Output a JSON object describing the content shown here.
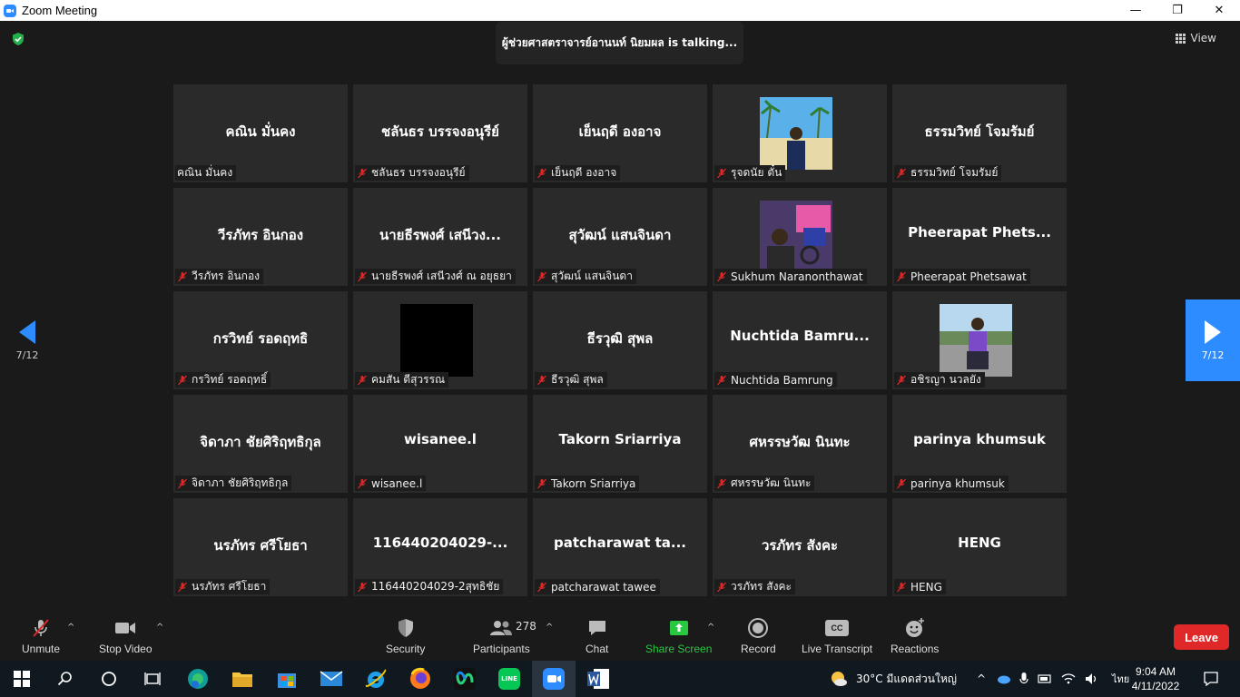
{
  "window": {
    "title": "Zoom Meeting",
    "minimize": "—",
    "restore": "❐",
    "close": "✕"
  },
  "meeting": {
    "talking": "ผู้ช่วยศาสตราจารย์อานนท์ นิยมผล is  talking...",
    "view_label": "View",
    "page_left": "7/12",
    "page_right": "7/12"
  },
  "participants": [
    {
      "big": "คณิน  มั่นคง",
      "label": "คณิน  มั่นคง",
      "muted": false
    },
    {
      "big": "ชลันธร บรรจงอนุรีย์",
      "label": "ชลันธร บรรจงอนุรีย์",
      "muted": true
    },
    {
      "big": "เย็นฤดี องอาจ",
      "label": "เย็นฤดี องอาจ",
      "muted": true
    },
    {
      "big": "",
      "label": "รุจดนัย ตั๋น",
      "muted": true,
      "photo": "beach"
    },
    {
      "big": "ธรรมวิทย์ โจมรัมย์",
      "label": "ธรรมวิทย์ โจมรัมย์",
      "muted": true
    },
    {
      "big": "วีรภัทร อินกอง",
      "label": "วีรภัทร อินกอง",
      "muted": true
    },
    {
      "big": "นายธีรพงศ์ เสนีวง...",
      "label": "นายธีรพงศ์ เสนีวงศ์ ณ อยุธยา",
      "muted": true
    },
    {
      "big": "สุวัฒน์ แสนจินดา",
      "label": "สุวัฒน์ แสนจินดา",
      "muted": true
    },
    {
      "big": "",
      "label": "Sukhum Naranonthawat",
      "muted": true,
      "photo": "arcade"
    },
    {
      "big": "Pheerapat  Phets...",
      "label": "Pheerapat Phetsawat",
      "muted": true
    },
    {
      "big": "กรวิทย์ รอดฤทธิ",
      "label": "กรวิทย์ รอดฤทธิ์",
      "muted": true
    },
    {
      "big": "",
      "label": "คมสัน ตีสุวรรณ",
      "muted": true,
      "photo": "black"
    },
    {
      "big": "ธีรวุฒิ สุพล",
      "label": "ธีรวุฒิ สุพล",
      "muted": true
    },
    {
      "big": "Nuchtida  Bamru...",
      "label": "Nuchtida Bamrung",
      "muted": true
    },
    {
      "big": "",
      "label": "อชิรญา นวลยัง",
      "muted": true,
      "photo": "road"
    },
    {
      "big": "จิดาภา ชัยศิริฤทธิกุล",
      "label": "จิดาภา ชัยศิริฤทธิกุล",
      "muted": true
    },
    {
      "big": "wisanee.l",
      "label": "wisanee.l",
      "muted": true
    },
    {
      "big": "Takorn Sriarriya",
      "label": "Takorn Sriarriya",
      "muted": true
    },
    {
      "big": "ศหรรษวัฒ นินทะ",
      "label": "ศหรรษวัฒ นินทะ",
      "muted": true
    },
    {
      "big": "parinya khumsuk",
      "label": "parinya khumsuk",
      "muted": true
    },
    {
      "big": "นรภัทร ศรีโยธา",
      "label": "นรภัทร ศรีโยธา",
      "muted": true
    },
    {
      "big": "116440204029-...",
      "label": "116440204029-2สุทธิชัย",
      "muted": true
    },
    {
      "big": "patcharawat  ta...",
      "label": "patcharawat tawee",
      "muted": true
    },
    {
      "big": "วรภัทร สังคะ",
      "label": "วรภัทร สังคะ",
      "muted": true
    },
    {
      "big": "HENG",
      "label": "HENG",
      "muted": true
    }
  ],
  "toolbar": {
    "unmute": "Unmute",
    "stop_video": "Stop Video",
    "security": "Security",
    "participants": "Participants",
    "participant_count": "278",
    "chat": "Chat",
    "share_screen": "Share Screen",
    "record": "Record",
    "live_transcript": "Live Transcript",
    "cc": "CC",
    "reactions": "Reactions",
    "leave": "Leave",
    "caret": "^"
  },
  "taskbar": {
    "weather": "30°C  มีแดดส่วนใหญ่",
    "lang": "ไทย",
    "time": "9:04 AM",
    "date": "4/11/2022",
    "line": "LINE"
  },
  "colors": {
    "accent": "#2d8cff",
    "leave": "#e02828",
    "share": "#28c840",
    "muted": "#e02828"
  }
}
